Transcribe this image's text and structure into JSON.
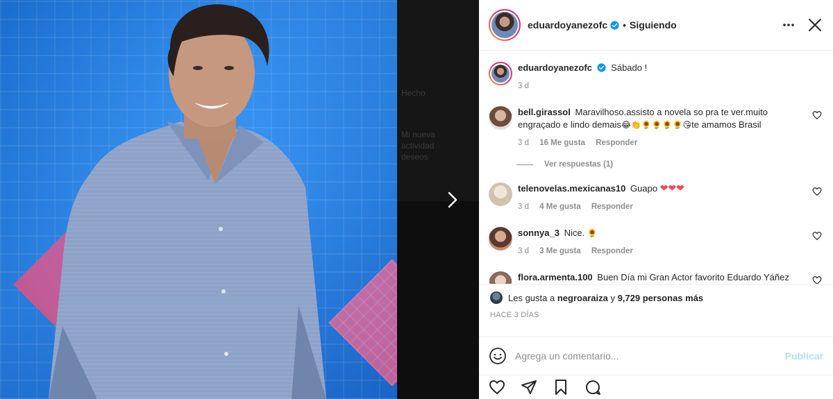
{
  "post": {
    "username": "eduardoyanezofc",
    "follow_status": "Siguiendo",
    "separator": "•"
  },
  "caption": {
    "username": "eduardoyanezofc",
    "text": "Sábado !",
    "time": "3 d"
  },
  "comments": [
    {
      "username": "bell.girassol",
      "text": "Maravilhoso.assisto a novela so pra te ver.muito engraçado e lindo demais",
      "emojis": "😂👏🌻🌻🌻🌻😘",
      "text_after": "te amamos Brasil",
      "time": "3 d",
      "likes": "16 Me gusta",
      "reply": "Responder",
      "view_replies": "Ver respuestas (1)"
    },
    {
      "username": "telenovelas.mexicanas10",
      "text": "Guapo",
      "emojis": "❤❤❤",
      "time": "3 d",
      "likes": "4 Me gusta",
      "reply": "Responder"
    },
    {
      "username": "sonnya_3",
      "text": "Nice.",
      "emojis": "🌻",
      "time": "3 d",
      "likes": "3 Me gusta",
      "reply": "Responder"
    },
    {
      "username": "flora.armenta.100",
      "text": "Buen Día mi Gran Actor favorito Eduardo Yáñez que hermoso luces me encanta mirarte así se mira que estás feliz bien guapo mi yañez te mando un fuerte abrazo con cariño DTBS siempre bendiciones y éxitos en todo lo que hagas mi Yañez"
    }
  ],
  "likes": {
    "prefix": "Les gusta a",
    "user": "negroaraiza",
    "middle": "y",
    "count": "9,729 personas más"
  },
  "time_ago": "HACE 3 DÍAS",
  "add_comment": {
    "placeholder": "Agrega un comentario...",
    "publish": "Publicar"
  },
  "background_text": {
    "line1": "Hecho",
    "line2": "Mi nueva",
    "line3": "actividad",
    "line4": "deseos"
  },
  "colors": {
    "verified": "#0095f6",
    "publish_disabled": "#b2dffc",
    "heart_red": "#ed4956",
    "story_ring": "#e1306c"
  }
}
